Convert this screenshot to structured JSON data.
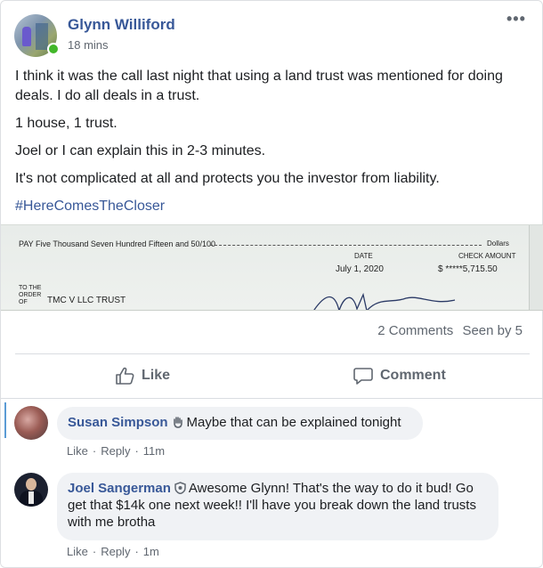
{
  "post": {
    "author": "Glynn Williford",
    "time": "18 mins",
    "paragraphs": [
      "I think it was the call last night that using a land trust was mentioned for doing deals. I do all deals in a trust.",
      "1 house, 1 trust.",
      "Joel or I can explain this in 2-3 minutes.",
      "It's not complicated at all and protects you the investor from liability."
    ],
    "hashtag": "#HereComesTheCloser",
    "more_icon": "ellipsis-icon"
  },
  "check_image": {
    "pay_line": "PAY Five Thousand Seven Hundred Fifteen and 50/100",
    "dollars_label": "Dollars",
    "date_label": "DATE",
    "check_amount_label": "CHECK AMOUNT",
    "date": "July 1, 2020",
    "amount": "$ *****5,715.50",
    "order_label": "TO THE ORDER OF",
    "payee": "TMC V LLC TRUST"
  },
  "stats": {
    "comments": "2 Comments",
    "seen": "Seen by 5"
  },
  "actions": {
    "like": "Like",
    "comment": "Comment"
  },
  "comments": [
    {
      "name": "Susan Simpson",
      "badge_icon": "wave-hand-icon",
      "text": "Maybe that can be explained tonight",
      "like": "Like",
      "reply": "Reply",
      "time": "11m"
    },
    {
      "name": "Joel Sangerman",
      "badge_icon": "shield-badge-icon",
      "text": "Awesome Glynn! That's the way to do it bud! Go get that $14k one next week!! I'll have you break down the land trusts with me brotha",
      "like": "Like",
      "reply": "Reply",
      "time": "1m"
    }
  ],
  "colors": {
    "link": "#385898",
    "online": "#42b72a",
    "muted": "#606770",
    "bubble": "#f0f2f5"
  }
}
